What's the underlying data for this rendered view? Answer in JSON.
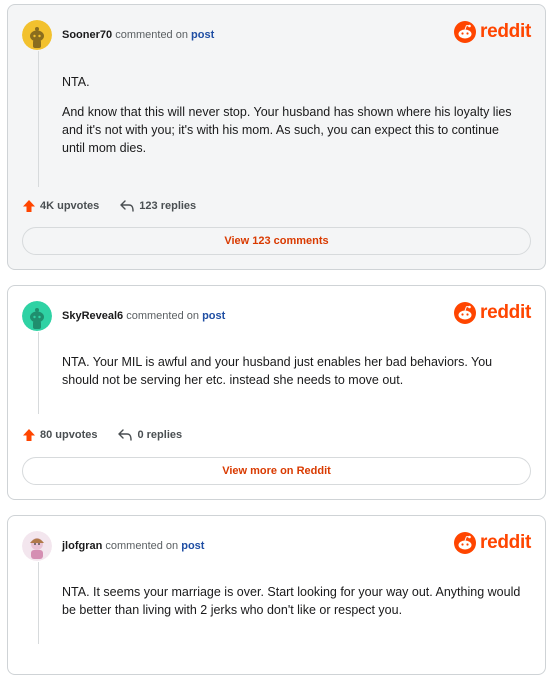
{
  "brand": {
    "name": "reddit",
    "color": "#ff4500"
  },
  "comments": [
    {
      "username": "Sooner70",
      "commented_on": "commented on",
      "post_link": "post",
      "paragraphs": [
        "NTA.",
        "And know that this will never stop. Your husband has shown where his loyalty lies and it's not with you; it's with his mom. As such, you can expect this to continue until mom dies."
      ],
      "upvotes": "4K upvotes",
      "replies": "123 replies",
      "button": "View 123 comments",
      "avatar_color": "#f2c12e"
    },
    {
      "username": "SkyReveal6",
      "commented_on": "commented on",
      "post_link": "post",
      "paragraphs": [
        "NTA. Your MIL is awful and your husband just enables her bad behaviors. You should not be serving her etc. instead she needs to move out."
      ],
      "upvotes": "80 upvotes",
      "replies": "0 replies",
      "button": "View more on Reddit",
      "avatar_color": "#2fd2a4"
    },
    {
      "username": "jlofgran",
      "commented_on": "commented on",
      "post_link": "post",
      "paragraphs": [
        "NTA. It seems your marriage is over. Start looking for your way out. Anything would be better than living with 2 jerks who don't like or respect you."
      ],
      "avatar_color": "#e9c4d6"
    }
  ]
}
